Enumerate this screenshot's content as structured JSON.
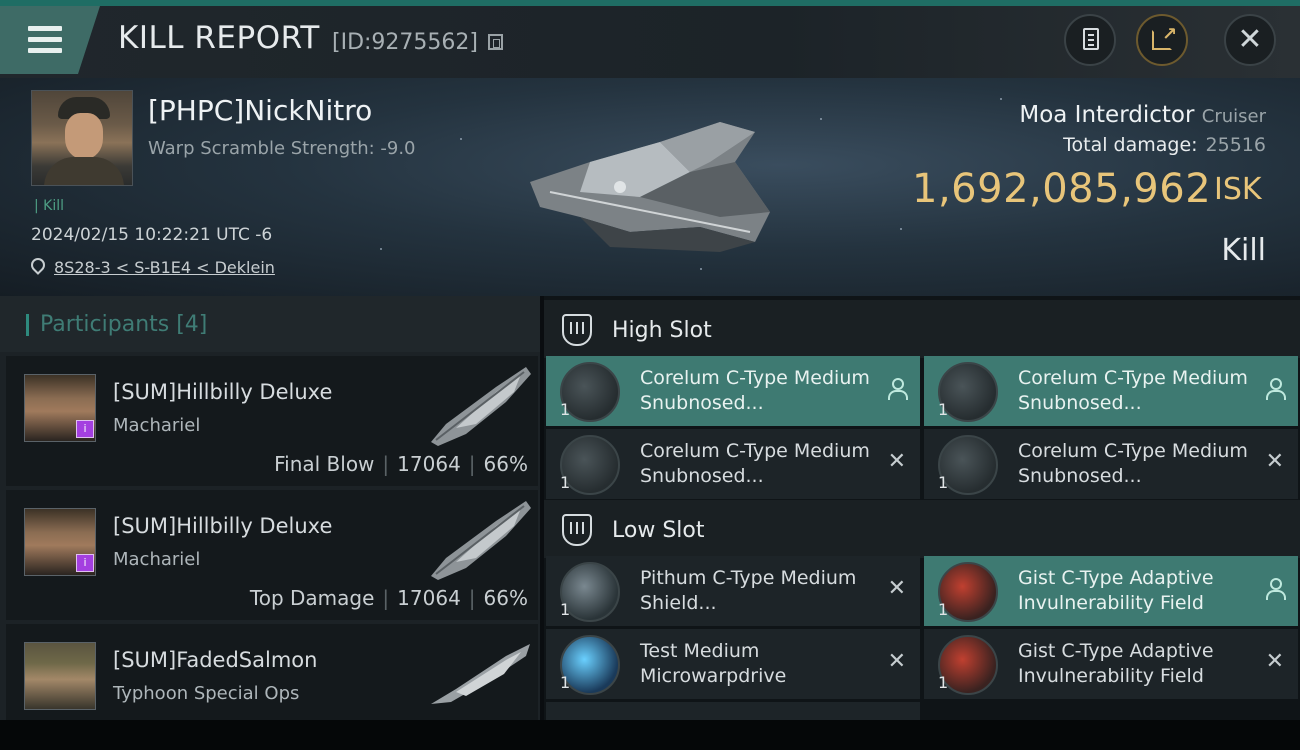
{
  "header": {
    "title": "KILL REPORT",
    "report_id": "[ID:9275562]"
  },
  "victim": {
    "name": "[PHPC]NickNitro",
    "attribute": "Warp Scramble Strength: -9.0",
    "kill_tag": "Kill",
    "datetime": "2024/02/15 10:22:21 UTC -6",
    "location": "8S28-3 < S-B1E4 < Deklein",
    "ship_name": "Moa Interdictor",
    "ship_class": "Cruiser",
    "total_damage_label": "Total damage:",
    "total_damage": "25516",
    "isk_value": "1,692,085,962",
    "isk_unit": "ISK",
    "result": "Kill"
  },
  "participants": {
    "header": "Participants [4]",
    "rows": [
      {
        "name": "[SUM]Hillbilly Deluxe",
        "ship": "Machariel",
        "tag": "Final Blow",
        "damage": "17064",
        "percent": "66%"
      },
      {
        "name": "[SUM]Hillbilly Deluxe",
        "ship": "Machariel",
        "tag": "Top Damage",
        "damage": "17064",
        "percent": "66%"
      },
      {
        "name": "[SUM]FadedSalmon",
        "ship": "Typhoon Special Ops",
        "tag": "",
        "damage": "",
        "percent": ""
      }
    ]
  },
  "slots": {
    "high_label": "High Slot",
    "low_label": "Low Slot",
    "high_modules": [
      {
        "name": "Corelum C-Type Medium Snubnosed...",
        "qty": "1",
        "state": "fitted",
        "highlight": true
      },
      {
        "name": "Corelum C-Type Medium Snubnosed...",
        "qty": "1",
        "state": "fitted",
        "highlight": true
      },
      {
        "name": "Corelum C-Type Medium Snubnosed...",
        "qty": "1",
        "state": "destroyed",
        "highlight": false
      },
      {
        "name": "Corelum C-Type Medium Snubnosed...",
        "qty": "1",
        "state": "destroyed",
        "highlight": false
      }
    ],
    "low_modules": [
      {
        "name": "Pithum C-Type Medium Shield...",
        "qty": "1",
        "state": "destroyed",
        "highlight": false
      },
      {
        "name": "Gist C-Type Adaptive Invulnerability Field",
        "qty": "1",
        "state": "fitted",
        "highlight": true
      },
      {
        "name": "Test Medium Microwarpdrive",
        "qty": "1",
        "state": "destroyed",
        "highlight": false
      },
      {
        "name": "Gist C-Type Adaptive Invulnerability Field",
        "qty": "1",
        "state": "destroyed",
        "highlight": false
      }
    ],
    "destroyed_glyph": "✕"
  },
  "colors": {
    "accent_teal": "#3e7a72",
    "isk_gold": "#e8c57a",
    "header_bar": "#1f6d64"
  }
}
